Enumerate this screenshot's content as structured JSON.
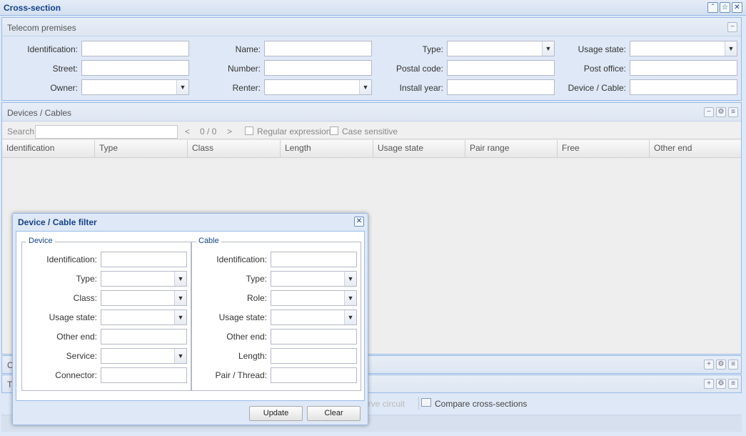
{
  "window": {
    "title": "Cross-section",
    "controls": [
      "collapse-icon",
      "pin-icon",
      "close-icon"
    ]
  },
  "premises": {
    "title": "Telecom premises",
    "labels": {
      "identification": "Identification:",
      "name": "Name:",
      "type": "Type:",
      "usage_state": "Usage state:",
      "street": "Street:",
      "number": "Number:",
      "postal_code": "Postal code:",
      "post_office": "Post office:",
      "owner": "Owner:",
      "renter": "Renter:",
      "install_year": "Install year:",
      "device_cable": "Device / Cable:"
    }
  },
  "devices": {
    "title": "Devices / Cables",
    "search_label": "Search",
    "pager_prev": "<",
    "pager_text": "0 / 0",
    "pager_next": ">",
    "regex_label": "Regular expression",
    "case_label": "Case sensitive",
    "columns": [
      "Identification",
      "Type",
      "Class",
      "Length",
      "Usage state",
      "Pair range",
      "Free",
      "Other end"
    ]
  },
  "lower_panels": {
    "panel1_initial": "C",
    "panel2_initial": "T",
    "reserve_circuit": "erve circuit",
    "compare_label": "Compare cross-sections"
  },
  "dialog": {
    "title": "Device / Cable filter",
    "device": {
      "legend": "Device",
      "labels": [
        "Identification:",
        "Type:",
        "Class:",
        "Usage state:",
        "Other end:",
        "Service:",
        "Connector:"
      ]
    },
    "cable": {
      "legend": "Cable",
      "labels": [
        "Identification:",
        "Type:",
        "Role:",
        "Usage state:",
        "Other end:",
        "Length:",
        "Pair / Thread:"
      ]
    },
    "update_label": "Update",
    "clear_label": "Clear"
  },
  "colors": {
    "accent": "#15428b",
    "border": "#99bbe8",
    "background": "#dfe8f6"
  }
}
